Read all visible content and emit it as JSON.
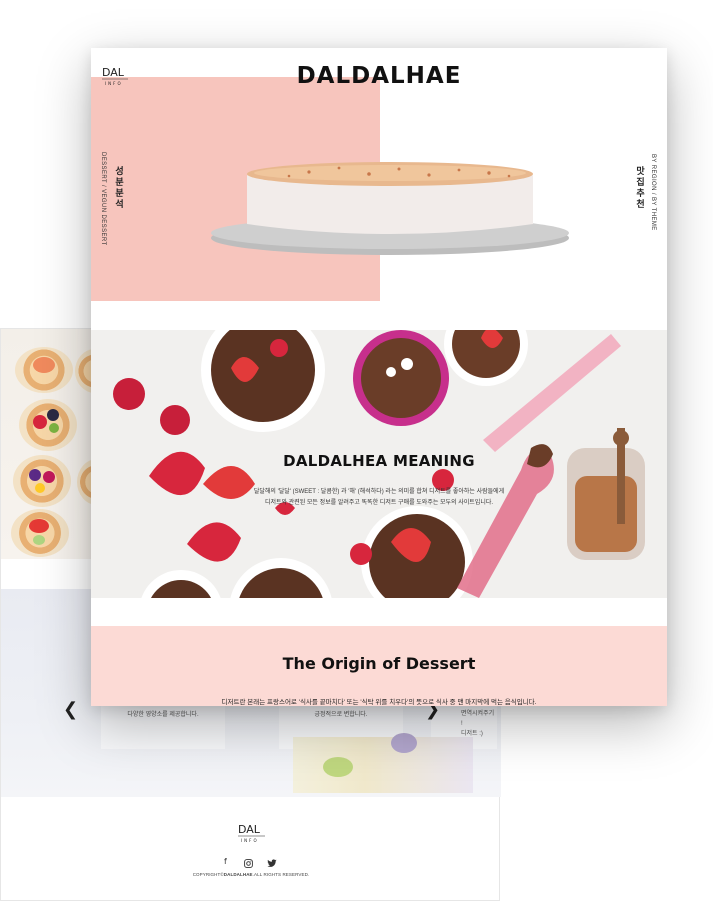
{
  "brand": {
    "title": "DALDALHAE",
    "logo_top": "DAL",
    "logo_sub": "INFO"
  },
  "side_menu": {
    "left_ko": "성분분석",
    "left_en": "DESSERT / VEGUN DESSERT",
    "right_ko": "맛집추천",
    "right_en": "BY REGION / BY THEME"
  },
  "meaning": {
    "title": "DALDALHEA MEANING",
    "line1": "달달해의 '달달' (SWEET : 달콤한) 과 '해' (해석하다) 라는 의미를 합쳐 디저트를 좋아하는 사람들에게",
    "line2": "디저트와 관련된 모든 정보를 알려주고 똑똑한 디저트 구매를 도와주는 모두의 사이트입니다."
  },
  "origin": {
    "title": "The Origin of Dessert",
    "text": "디저트란 본래는 프랑스어로 '식사를 끝마치다' 또는 '식탁 위를 치우다'의 뜻으로 식사 중 맨 마지막에 먹는 음식입니다."
  },
  "slider": {
    "cards": [
      {
        "text": "다양한 영양소를 제공합니다."
      },
      {
        "text": "긍정적으로 변합니다."
      },
      {
        "text": "면역시켜주기 !"
      },
      {
        "text": "디저트 :)"
      }
    ],
    "prev_icon": "chevron-left-icon",
    "next_icon": "chevron-right-icon"
  },
  "footer": {
    "logo_top": "DAL",
    "logo_sub": "INFO",
    "social": [
      "facebook-icon",
      "instagram-icon",
      "twitter-icon"
    ],
    "copyright_pre": "COPYRIGHT©",
    "copyright_brand": "DALDALHAE",
    "copyright_post": ".ALL RIGHTS RESERVED."
  },
  "colors": {
    "pink_block": "#f7c5bd",
    "origin_bg": "#fcdad5",
    "text": "#111111"
  }
}
